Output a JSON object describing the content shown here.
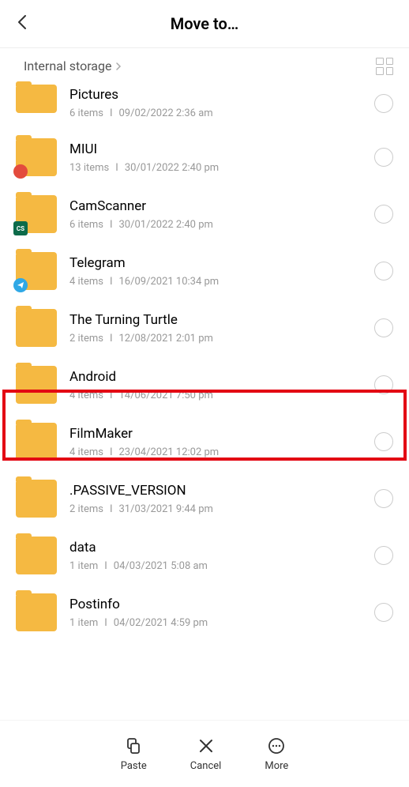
{
  "header": {
    "title": "Move to…"
  },
  "breadcrumb": {
    "label": "Internal storage"
  },
  "folders": [
    {
      "name": "Pictures",
      "count": "6 items",
      "date": "09/02/2022 2:36 am",
      "badge": null
    },
    {
      "name": "MIUI",
      "count": "13 items",
      "date": "30/01/2022 2:40 pm",
      "badge": "red"
    },
    {
      "name": "CamScanner",
      "count": "6 items",
      "date": "30/01/2022 2:40 pm",
      "badge": "green",
      "badgeText": "CS"
    },
    {
      "name": "Telegram",
      "count": "4 items",
      "date": "16/09/2021 10:34 pm",
      "badge": "blue"
    },
    {
      "name": "The Turning Turtle",
      "count": "2 items",
      "date": "12/08/2021 2:01 pm",
      "badge": null
    },
    {
      "name": "Android",
      "count": "4 items",
      "date": "14/06/2021 7:50 pm",
      "badge": null
    },
    {
      "name": "FilmMaker",
      "count": "4 items",
      "date": "23/04/2021 12:02 pm",
      "badge": null
    },
    {
      "name": ".PASSIVE_VERSION",
      "count": "2 items",
      "date": "31/03/2021 9:44 pm",
      "badge": null
    },
    {
      "name": "data",
      "count": "1 item",
      "date": "04/03/2021 5:08 am",
      "badge": null
    },
    {
      "name": "Postinfo",
      "count": "1 item",
      "date": "04/02/2021 4:59 pm",
      "badge": null
    }
  ],
  "actions": {
    "paste": "Paste",
    "cancel": "Cancel",
    "more": "More"
  }
}
